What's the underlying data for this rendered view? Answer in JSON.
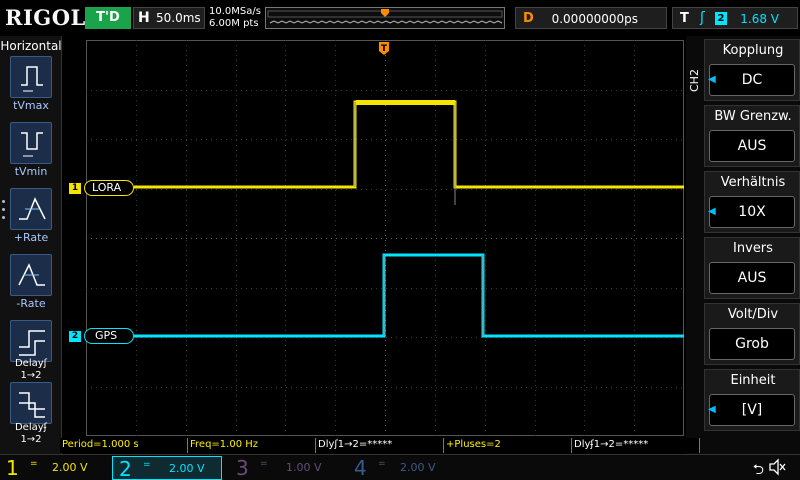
{
  "topbar": {
    "brand": "RIGOL",
    "run_state": "T'D",
    "timebase_label": "H",
    "timebase_value": "50.0ms",
    "sample_rate": "10.0MSa/s",
    "memory_depth": "6.00M pts",
    "delay_label": "D",
    "delay_value": "0.00000000ps",
    "trigger_label": "T",
    "trigger_edge_icon": "rising-edge-icon",
    "trigger_source": "2",
    "trigger_level": "1.68 V"
  },
  "left_menu": {
    "title": "Horizontal",
    "items": [
      {
        "label": "tVmax",
        "icon": "tvmax-icon"
      },
      {
        "label": "tVmin",
        "icon": "tvmin-icon"
      },
      {
        "label": "+Rate",
        "icon": "positive-rate-icon"
      },
      {
        "label": "-Rate",
        "icon": "negative-rate-icon"
      },
      {
        "label": "Delayʃ",
        "sub": "1→2",
        "icon": "delay-rise-icon"
      },
      {
        "label": "Delayʄ",
        "sub": "1→2",
        "icon": "delay-fall-icon"
      }
    ]
  },
  "channels": [
    {
      "id": "1",
      "name": "LORA",
      "color": "#f5e400"
    },
    {
      "id": "2",
      "name": "GPS",
      "color": "#00e5ff"
    }
  ],
  "right_menu": {
    "channel_tag": "CH2",
    "items": [
      {
        "title": "Kopplung",
        "value": "DC",
        "arrow": true
      },
      {
        "title": "BW Grenzw.",
        "value": "AUS",
        "arrow": false
      },
      {
        "title": "Verhältnis",
        "value": "10X",
        "arrow": true
      },
      {
        "title": "Invers",
        "value": "AUS",
        "arrow": false
      },
      {
        "title": "Volt/Div",
        "value": "Grob",
        "arrow": false
      },
      {
        "title": "Einheit",
        "value": "[V]",
        "arrow": true
      }
    ]
  },
  "measurements": [
    {
      "text": "Period=1.000 s",
      "color": "yellow"
    },
    {
      "text": "Freq=1.00 Hz",
      "color": "yellow"
    },
    {
      "text": "Dlyʃ1→2=*****",
      "color": "white"
    },
    {
      "text": "+Pluses=2",
      "color": "yellow"
    },
    {
      "text": "Dlyʄ1→2=*****",
      "color": "white"
    }
  ],
  "bottom_channels": [
    {
      "num": "1",
      "coupling": "=",
      "volts": "2.00 V",
      "color": "#f5e400",
      "active": false
    },
    {
      "num": "2",
      "coupling": "=",
      "volts": "2.00 V",
      "color": "#00e5ff",
      "active": true
    },
    {
      "num": "3",
      "coupling": "=",
      "volts": "1.00 V",
      "color": "#6a4b7a",
      "active": false
    },
    {
      "num": "4",
      "coupling": "=",
      "volts": "2.00 V",
      "color": "#3a5a8a",
      "active": false
    }
  ],
  "status_icons": [
    "usb-icon",
    "speaker-mute-icon"
  ],
  "trigger_marker": "T"
}
